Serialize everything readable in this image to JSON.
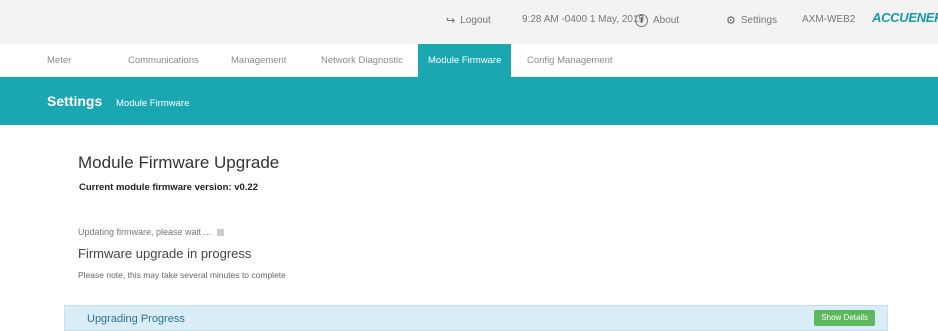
{
  "header": {
    "logout_label": "Logout",
    "datetime": "9:28 AM -0400 1 May, 2019",
    "about_label": "About",
    "settings_label": "Settings",
    "device_name": "AXM-WEB2",
    "logo_text": "ACCUENERGY",
    "accent_color": "#1ba7b1"
  },
  "tabs": [
    {
      "label": "Meter"
    },
    {
      "label": "Communications"
    },
    {
      "label": "Management"
    },
    {
      "label": "Network Diagnostic"
    },
    {
      "label": "Module Firmware",
      "active": true
    },
    {
      "label": "Config Management"
    }
  ],
  "band": {
    "title": "Settings",
    "subtitle": "Module Firmware"
  },
  "main": {
    "heading": "Module Firmware Upgrade",
    "current_version": "Current module firmware version: v0.22",
    "updating_text": "Updating firmware, please wait ...",
    "progress_heading": "Firmware upgrade in progress",
    "note": "Please note, this may take several minutes to complete"
  },
  "panel": {
    "title": "Upgrading Progress",
    "button_label": "Show Details",
    "button_color": "#5cb85c"
  }
}
